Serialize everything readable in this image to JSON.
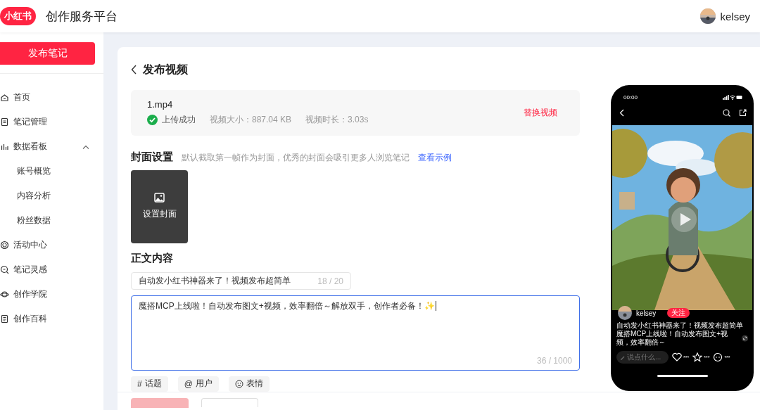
{
  "header": {
    "logo": "小红书",
    "title": "创作服务平台",
    "user": "kelsey"
  },
  "sidebar": {
    "publish_button": "发布笔记",
    "items": [
      {
        "label": "首页"
      },
      {
        "label": "笔记管理"
      },
      {
        "label": "数据看板",
        "expanded": true,
        "children": [
          {
            "label": "账号概览"
          },
          {
            "label": "内容分析"
          },
          {
            "label": "粉丝数据"
          }
        ]
      },
      {
        "label": "活动中心"
      },
      {
        "label": "笔记灵感"
      },
      {
        "label": "创作学院"
      },
      {
        "label": "创作百科"
      }
    ]
  },
  "editor": {
    "page_title": "发布视频",
    "upload": {
      "file": "1.mp4",
      "status": "上传成功",
      "size": "视频大小：887.04 KB",
      "duration": "视频时长：3.03s",
      "replace": "替换视频"
    },
    "cover": {
      "heading": "封面设置",
      "hint": "默认截取第一帧作为封面，优秀的封面会吸引更多人浏览笔记",
      "example_link": "查看示例",
      "button": "设置封面"
    },
    "body": {
      "heading": "正文内容",
      "title_value": "自动发小红书神器来了！视频发布超简单",
      "title_count": "18 / 20",
      "text_value": "魔搭MCP上线啦！自动发布图文+视频，效率翻倍～解放双手，创作者必备！✨",
      "text_count": "36 / 1000",
      "tools": [
        {
          "kind": "symbol",
          "symbol": "#",
          "label": "话题"
        },
        {
          "kind": "symbol",
          "symbol": "@",
          "label": "用户"
        },
        {
          "kind": "emoji",
          "label": "表情"
        }
      ]
    }
  },
  "preview": {
    "time": "00:00",
    "author": "kelsey",
    "follow": "关注",
    "title": "自动发小红书神器来了！视频发布超简单",
    "text": "魔搭MCP上线啦！自动发布图文+视频，效率翻倍～",
    "comment_placeholder": "说点什么...",
    "counts": [
      "***",
      "***",
      "***"
    ]
  }
}
